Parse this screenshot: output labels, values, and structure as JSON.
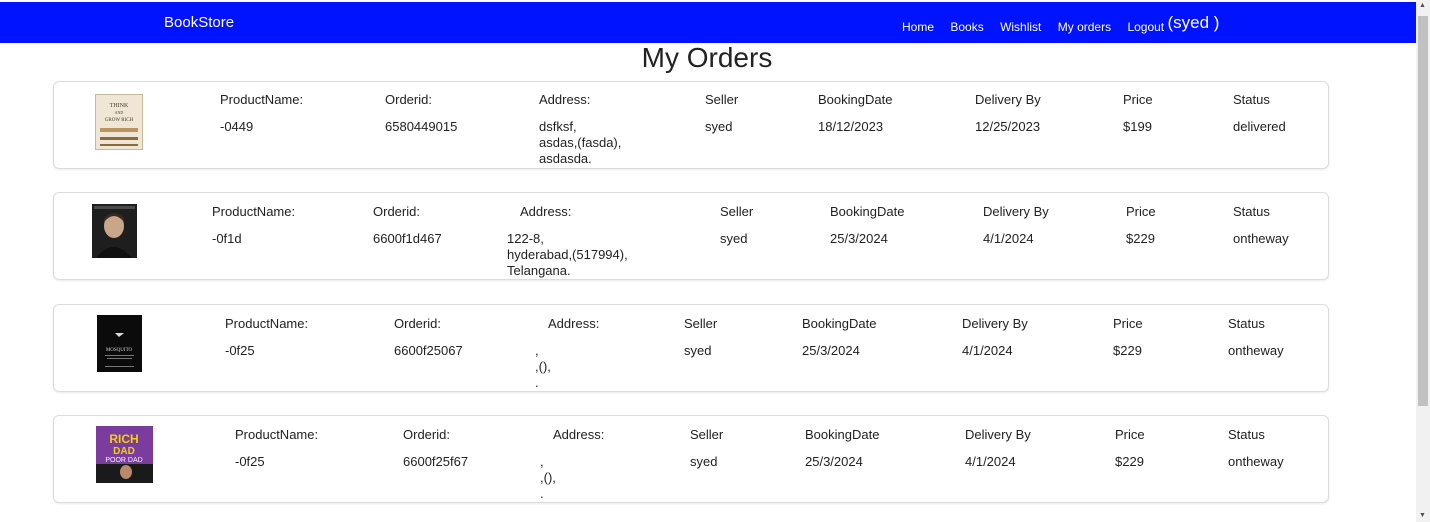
{
  "nav": {
    "brand": "BookStore",
    "links": [
      "Home",
      "Books",
      "Wishlist",
      "My orders",
      "Logout"
    ],
    "user": "(syed )"
  },
  "page_title": "My Orders",
  "labels": {
    "product": "ProductName:",
    "orderid": "Orderid:",
    "address": "Address:",
    "seller": "Seller",
    "booking": "BookingDate",
    "delivery": "Delivery By",
    "price": "Price",
    "status": "Status"
  },
  "orders": [
    {
      "cover": "think-and-grow-rich-cover",
      "cover_title": "THINK AND GROW RICH",
      "product": "-0449",
      "orderid": "6580449015",
      "address": [
        "dsfksf,",
        "asdas,(fasda),",
        "asdasda."
      ],
      "seller": "syed",
      "booking": "18/12/2023",
      "delivery": "12/25/2023",
      "price": "$199",
      "status": "delivered"
    },
    {
      "cover": "portrait-cover",
      "product": "-0f1d",
      "orderid": "6600f1d467",
      "address": [
        "122-8,",
        "hyderabad,(517994),",
        "Telangana."
      ],
      "seller": "syed",
      "booking": "25/3/2024",
      "delivery": "4/1/2024",
      "price": "$229",
      "status": "ontheway"
    },
    {
      "cover": "mosquito-cover",
      "cover_title": "MOSQUITO",
      "product": "-0f25",
      "orderid": "6600f25067",
      "address": [
        ",",
        ",(),",
        "."
      ],
      "seller": "syed",
      "booking": "25/3/2024",
      "delivery": "4/1/2024",
      "price": "$229",
      "status": "ontheway"
    },
    {
      "cover": "rich-dad-poor-dad-cover",
      "cover_title": "RICH DAD",
      "cover_subtitle": "POOR DAD",
      "product": "-0f25",
      "orderid": "6600f25f67",
      "address": [
        ",",
        ",(),",
        "."
      ],
      "seller": "syed",
      "booking": "25/3/2024",
      "delivery": "4/1/2024",
      "price": "$229",
      "status": "ontheway"
    }
  ]
}
